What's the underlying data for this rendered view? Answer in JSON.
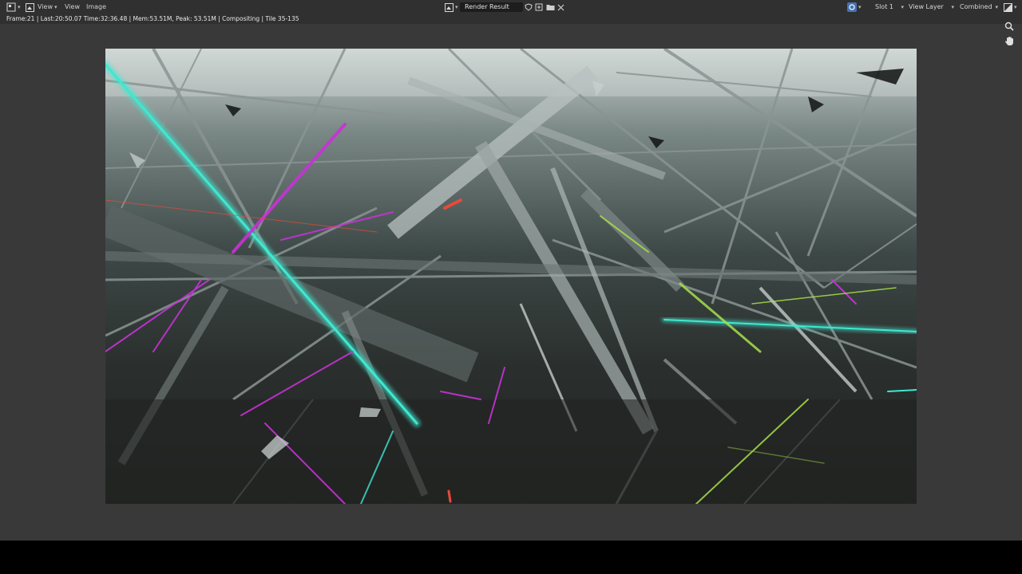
{
  "header": {
    "editor_type_icon": "image-editor-icon",
    "view_mode_icon": "image-view-icon",
    "menus": [
      "View",
      "View",
      "Image"
    ],
    "image_browse_icon": "image-browse-icon",
    "image_name": "Render Result",
    "fake_user_icon": "shield-icon",
    "new_image_icon": "new-image-icon",
    "open_image_icon": "folder-icon",
    "close_icon": "close-icon",
    "gizmo_icon": "display-gizmo-icon",
    "slot": "Slot 1",
    "view_layer": "View Layer",
    "pass": "Combined",
    "display_channels_icon": "display-channels-icon"
  },
  "status": {
    "text": "Frame:21 | Last:20:50.07 Time:32:36.48 | Mem:53.51M, Peak: 53.51M | Compositing | Tile 35-135"
  },
  "navigation": {
    "zoom_icon": "zoom-icon",
    "pan_icon": "hand-icon"
  },
  "render": {
    "description_icon": "render-image",
    "colors": {
      "cyan": "#3fe8d0",
      "magenta": "#c832d8",
      "lime": "#a8e04a",
      "red": "#e84a3a",
      "steel": "#9aa4a2"
    }
  }
}
